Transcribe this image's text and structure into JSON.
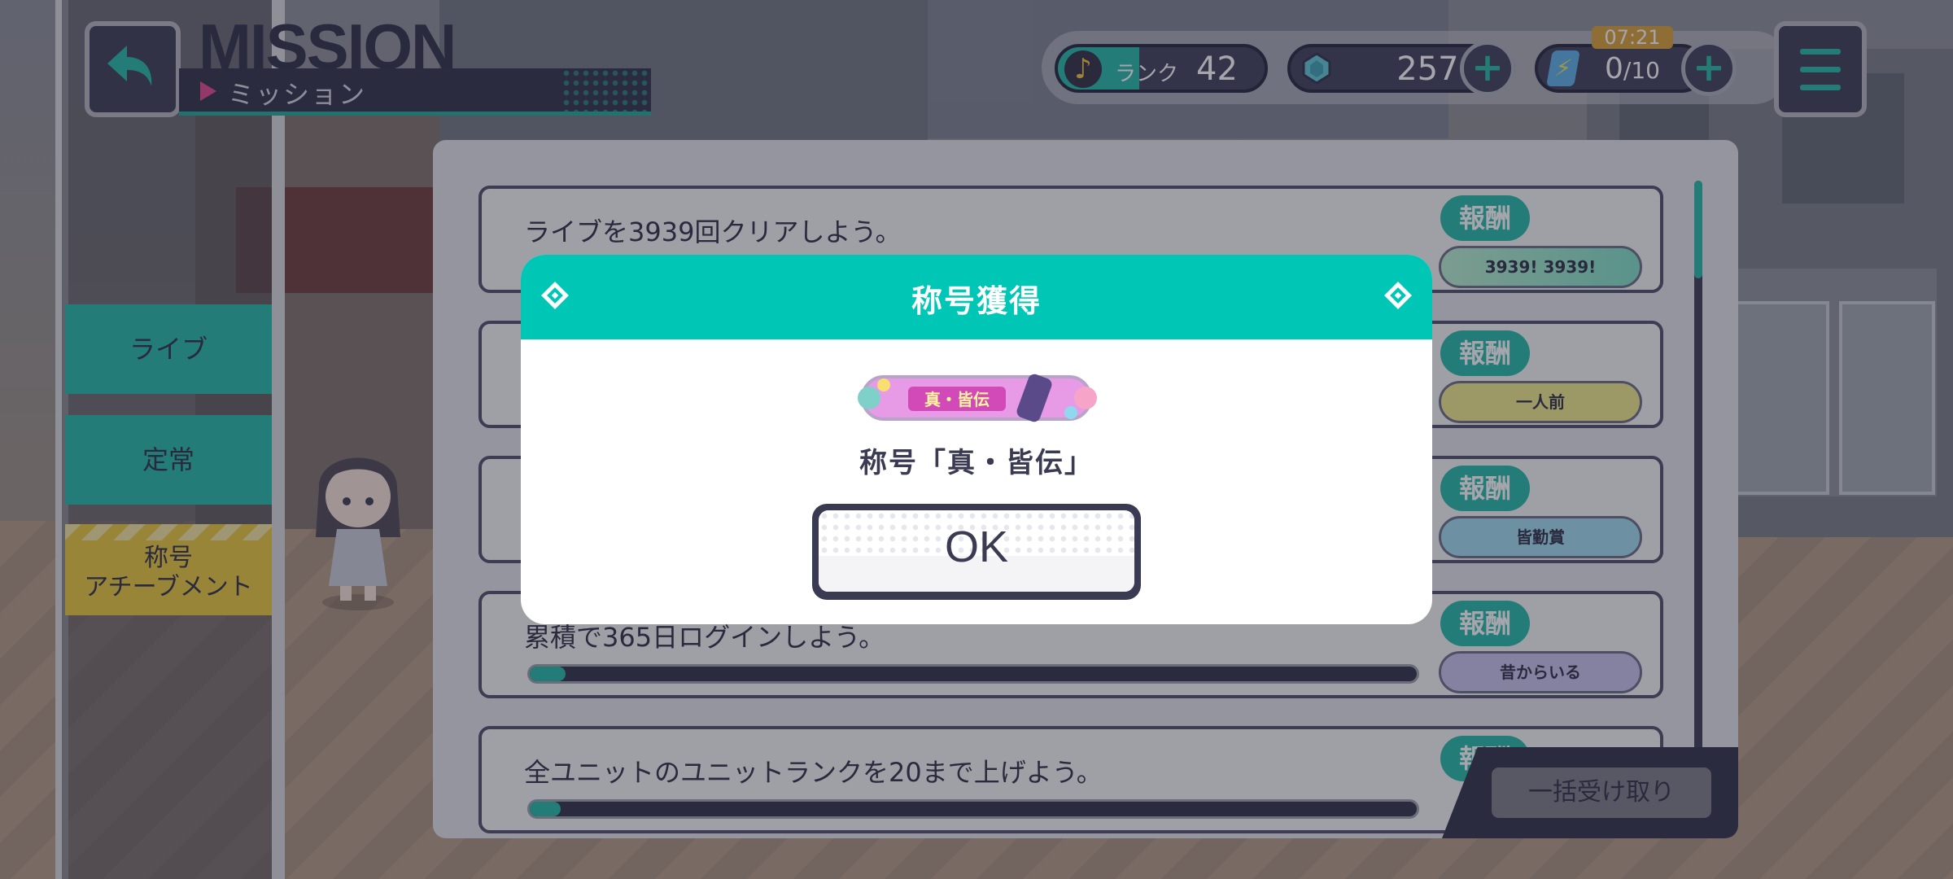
{
  "header": {
    "title": "MISSION",
    "subtitle": "ミッション"
  },
  "status": {
    "rank_label": "ランク",
    "rank_value": "42",
    "gems": "2570",
    "stamina_current": "0",
    "stamina_max": "/10",
    "timer": "07:21",
    "plus_label": "+"
  },
  "tabs": [
    {
      "label": "ライブ"
    },
    {
      "label": "定常"
    },
    {
      "label_line1": "称号",
      "label_line2": "アチーブメント"
    }
  ],
  "missions": [
    {
      "text": "ライブを3939回クリアしよう。",
      "reward_label": "報酬",
      "reward_item": "3939! 3939!",
      "progress": null
    },
    {
      "text": "",
      "reward_label": "報酬",
      "reward_item": "一人前",
      "progress": null
    },
    {
      "text": "",
      "reward_label": "報酬",
      "reward_item": "皆勤賞",
      "progress": null
    },
    {
      "text": "累積で365日ログインしよう。",
      "reward_label": "報酬",
      "reward_item": "昔からいる",
      "progress": 0.04
    },
    {
      "text": "全ユニットのユニットランクを20まで上げよう。",
      "reward_label": "報酬",
      "reward_item": "",
      "progress": 0.035
    }
  ],
  "collect_all": "一括受け取り",
  "dialog": {
    "title": "称号獲得",
    "badge_text": "真・皆伝",
    "title_name": "称号「真・皆伝」",
    "ok": "OK"
  },
  "colors": {
    "teal": "#00c6b5",
    "navy": "#3a3a52",
    "gold": "#e8c93a",
    "pink": "#e0458a"
  }
}
